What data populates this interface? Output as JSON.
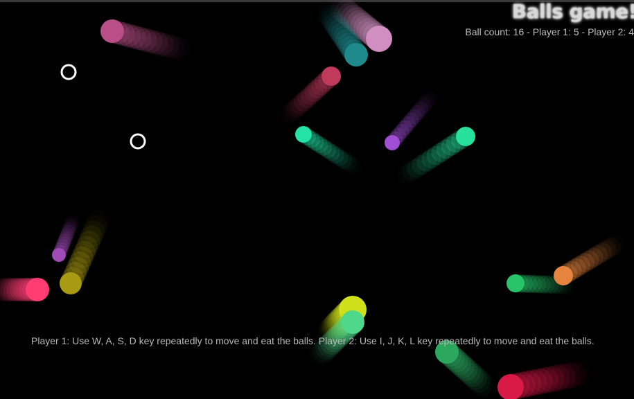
{
  "game": {
    "title": "Balls game!",
    "ball_count_label": "Ball count: 16 - Player 1: 5 - Player 2: 4",
    "instructions": "Player 1: Use W, A, S, D key repeatedly to move and eat the balls. Player 2: Use I, J, K, L key repeatedly to move and eat the balls."
  },
  "players": [
    {
      "name": "player-1",
      "color": "#ffffff"
    },
    {
      "name": "player-2",
      "color": "#ffffff"
    }
  ],
  "balls": [
    {
      "color": "#b94f86"
    },
    {
      "color": "#d08fc0"
    },
    {
      "color": "#1f8a8c"
    },
    {
      "color": "#24e3a4"
    },
    {
      "color": "#a24fd8"
    },
    {
      "color": "#27e09c"
    },
    {
      "color": "#a14bb8"
    },
    {
      "color": "#a89a12"
    },
    {
      "color": "#ff3d72"
    },
    {
      "color": "#28c46a"
    },
    {
      "color": "#e4843e"
    },
    {
      "color": "#cfe01b"
    },
    {
      "color": "#4fd88a"
    },
    {
      "color": "#2ca85e"
    },
    {
      "color": "#d91946"
    },
    {
      "color": "#c03a5c"
    }
  ]
}
